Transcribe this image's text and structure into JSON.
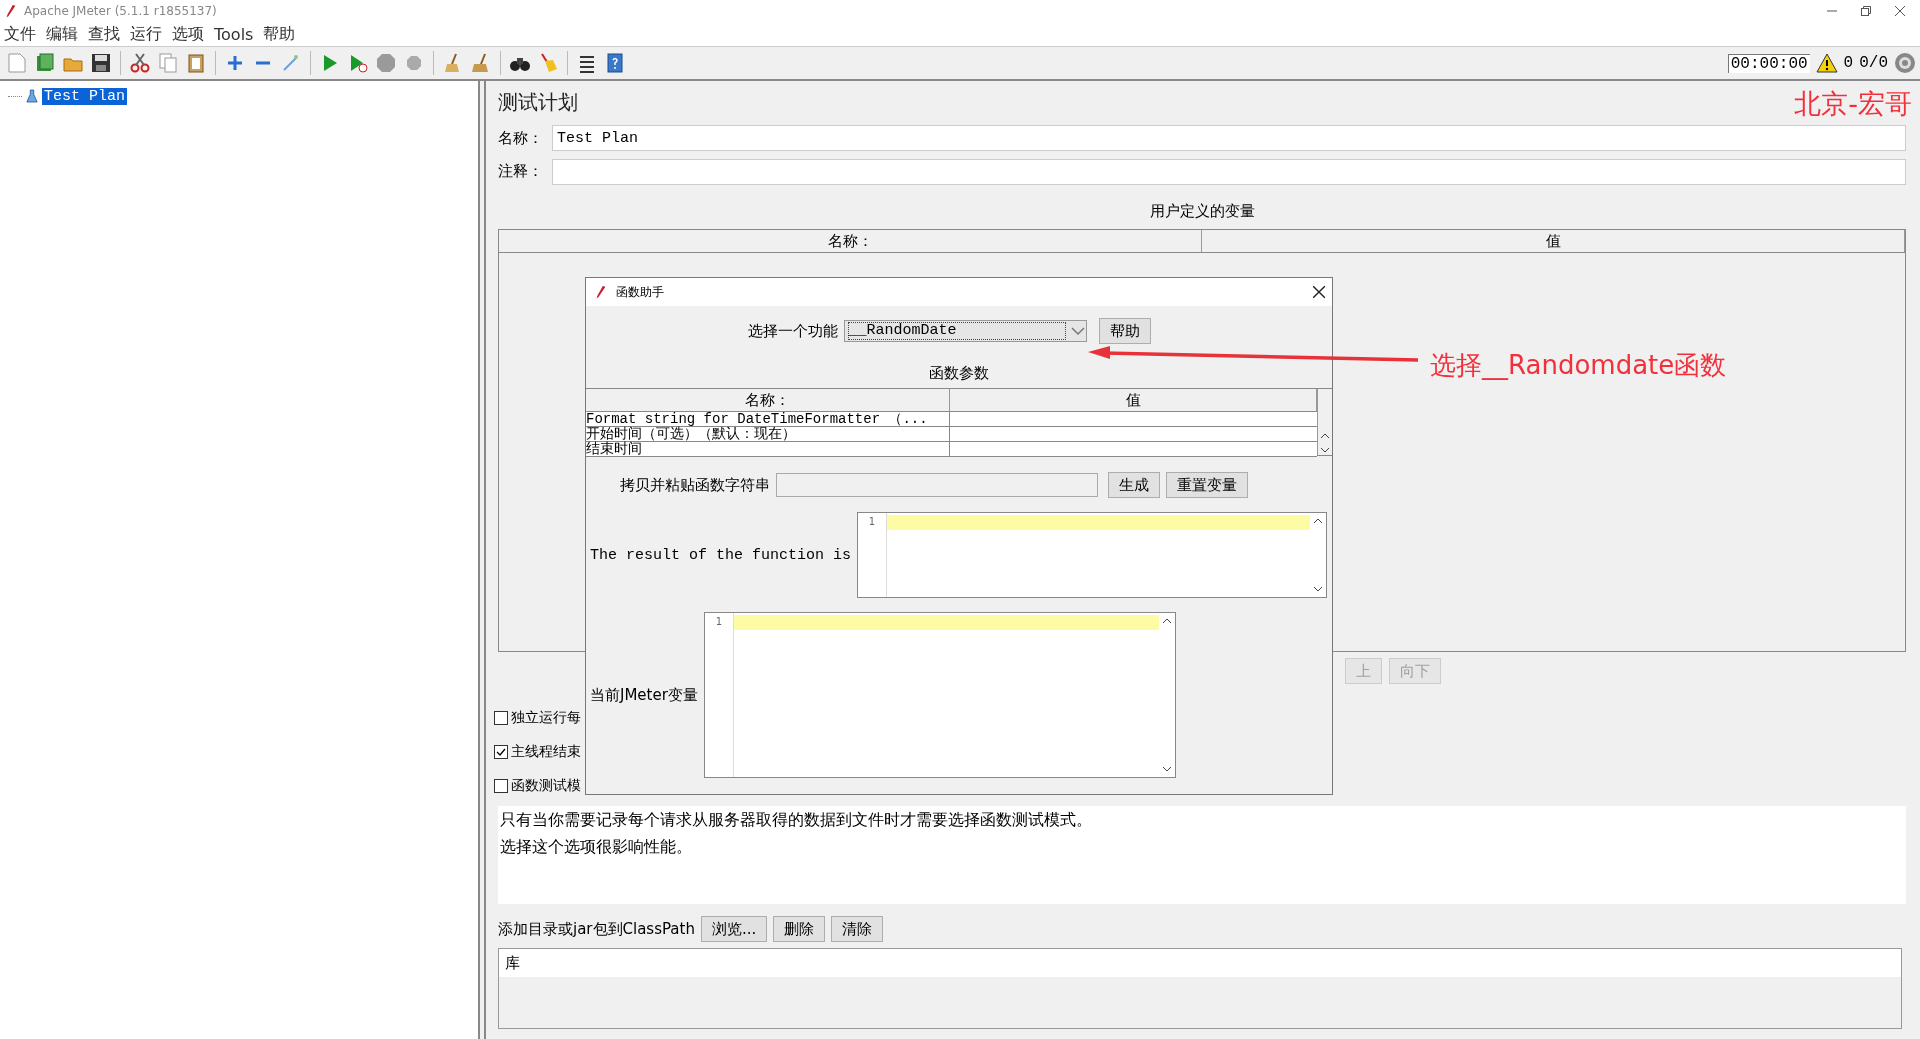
{
  "window": {
    "title": "Apache JMeter (5.1.1 r1855137)"
  },
  "menu": [
    "文件",
    "编辑",
    "查找",
    "运行",
    "选项",
    "Tools",
    "帮助"
  ],
  "status": {
    "timer": "00:00:00",
    "warnings": "0",
    "threads": "0/0"
  },
  "tree": [
    {
      "label": "Test Plan",
      "selected": true
    }
  ],
  "test_plan": {
    "heading": "测试计划",
    "name_label": "名称：",
    "name_value": "Test Plan",
    "comment_label": "注释：",
    "variables": {
      "title": "用户定义的变量",
      "columns": [
        "名称：",
        "值"
      ]
    },
    "buttons": [
      {
        "label": "上",
        "disabled": true
      },
      {
        "label": "向下",
        "disabled": true
      }
    ],
    "options": [
      {
        "label": "独立运行每",
        "checked": false
      },
      {
        "label": "主线程结束",
        "checked": true
      },
      {
        "label": "函数测试模",
        "checked": false
      }
    ],
    "info": [
      "只有当你需要记录每个请求从服务器取得的数据到文件时才需要选择函数测试模式。",
      "选择这个选项很影响性能。"
    ],
    "classpath": {
      "label": "添加目录或jar包到ClassPath",
      "buttons": [
        "浏览...",
        "删除",
        "清除"
      ],
      "column": "库"
    }
  },
  "dialog": {
    "title": "函数助手",
    "function_label": "选择一个功能",
    "function_value": "__RandomDate",
    "help_button": "帮助",
    "params_title": "函数参数",
    "params_columns": [
      "名称：",
      "值"
    ],
    "params_rows": [
      "Format string for DateTimeFormatter （...",
      "开始时间（可选）（默认：现在）",
      "结束时间"
    ],
    "copy_label": "拷贝并粘贴函数字符串",
    "generate_button": "生成",
    "reset_button": "重置变量",
    "result_label": "The result of the function is",
    "result_line": "1",
    "variables_label": "当前JMeter变量",
    "variables_line": "1"
  },
  "annotations": {
    "corner": "北京-宏哥",
    "callout": "选择__Randomdate函数"
  }
}
